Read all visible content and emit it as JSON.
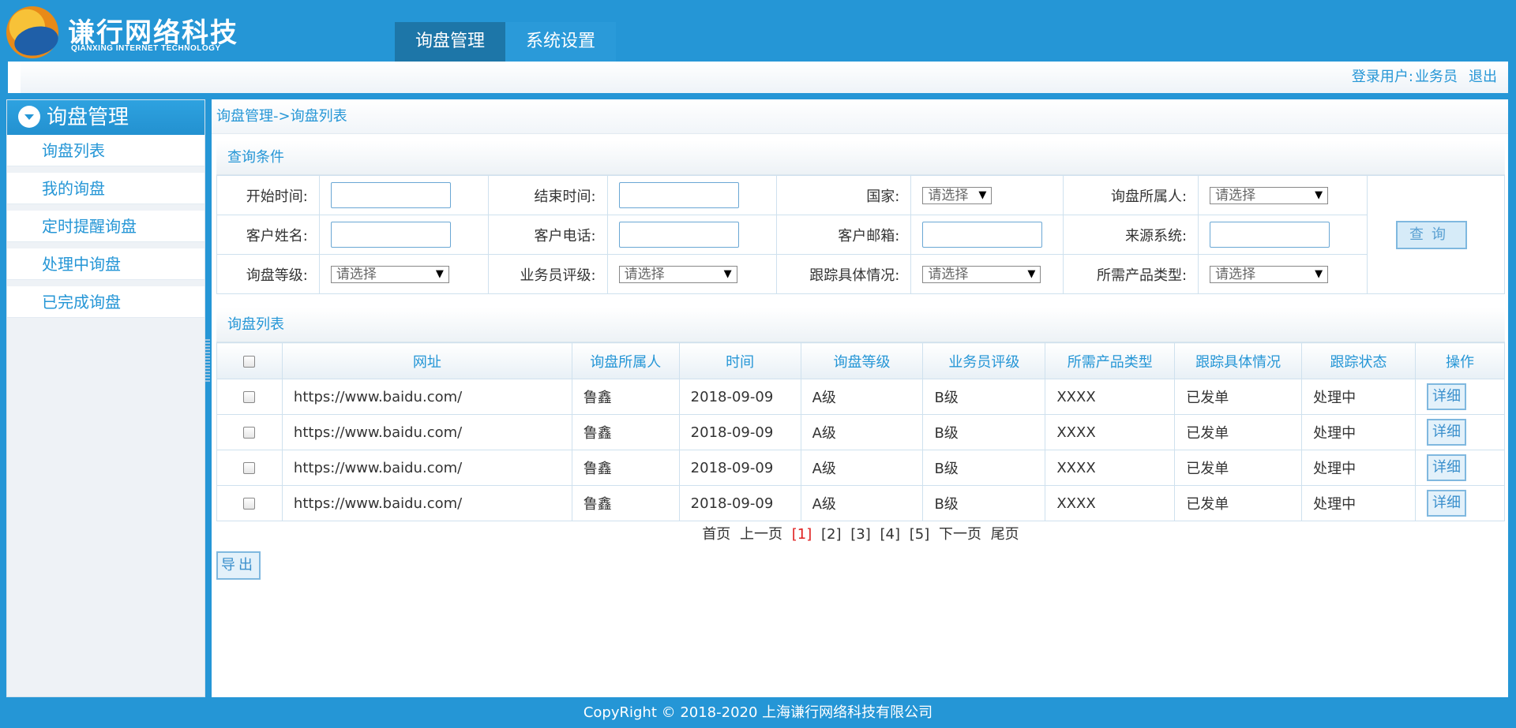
{
  "logo": {
    "title": "谦行网络科技",
    "subtitle": "QIANXING INTERNET TECHNOLOGY"
  },
  "topnav": [
    {
      "label": "询盘管理",
      "active": true
    },
    {
      "label": "系统设置",
      "active": false
    }
  ],
  "userbar": {
    "login_label": "登录用户:",
    "username": "业务员",
    "logout": "退出"
  },
  "sidebar": {
    "title": "询盘管理",
    "items": [
      "询盘列表",
      "我的询盘",
      "定时提醒询盘",
      "处理中询盘",
      "已完成询盘"
    ]
  },
  "breadcrumb": "询盘管理->询盘列表",
  "query": {
    "title": "查询条件",
    "fields": {
      "start_time": "开始时间:",
      "end_time": "结束时间:",
      "country": "国家:",
      "owner": "询盘所属人:",
      "customer_name": "客户姓名:",
      "customer_phone": "客户电话:",
      "customer_email": "客户邮箱:",
      "source_system": "来源系统:",
      "level": "询盘等级:",
      "sales_rating": "业务员评级:",
      "tracking_detail": "跟踪具体情况:",
      "product_type": "所需产品类型:"
    },
    "select_placeholder": "请选择",
    "button": "查询"
  },
  "list": {
    "title": "询盘列表",
    "columns": [
      "网址",
      "询盘所属人",
      "时间",
      "询盘等级",
      "业务员评级",
      "所需产品类型",
      "跟踪具体情况",
      "跟踪状态",
      "操作"
    ],
    "rows": [
      {
        "url": "https://www.baidu.com/",
        "owner": "鲁鑫",
        "date": "2018-09-09",
        "level": "A级",
        "rating": "B级",
        "product": "XXXX",
        "tracking": "已发单",
        "status": "处理中",
        "action": "详细"
      },
      {
        "url": "https://www.baidu.com/",
        "owner": "鲁鑫",
        "date": "2018-09-09",
        "level": "A级",
        "rating": "B级",
        "product": "XXXX",
        "tracking": "已发单",
        "status": "处理中",
        "action": "详细"
      },
      {
        "url": "https://www.baidu.com/",
        "owner": "鲁鑫",
        "date": "2018-09-09",
        "level": "A级",
        "rating": "B级",
        "product": "XXXX",
        "tracking": "已发单",
        "status": "处理中",
        "action": "详细"
      },
      {
        "url": "https://www.baidu.com/",
        "owner": "鲁鑫",
        "date": "2018-09-09",
        "level": "A级",
        "rating": "B级",
        "product": "XXXX",
        "tracking": "已发单",
        "status": "处理中",
        "action": "详细"
      }
    ]
  },
  "pager": {
    "first": "首页",
    "prev": "上一页",
    "pages": [
      "[1]",
      "[2]",
      "[3]",
      "[4]",
      "[5]"
    ],
    "current": "[1]",
    "next": "下一页",
    "last": "尾页"
  },
  "export_button": "导出",
  "footer": "CopyRight © 2018-2020 上海谦行网络科技有限公司",
  "colors": {
    "brand": "#2596d6",
    "active_tab": "#1d76a8",
    "current_page": "#e02020"
  }
}
